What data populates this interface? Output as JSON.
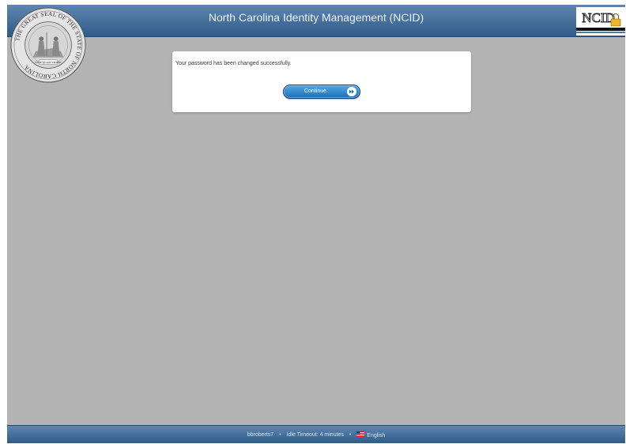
{
  "header": {
    "title": "North Carolina Identity Management (NCID)",
    "seal_text_top": "THE GREAT SEAL OF THE STATE OF NORTH CAROLINA",
    "seal_motto": "ESSE QUAM VIDERI",
    "logo_text": "NCID"
  },
  "dialog": {
    "message": "Your password has been changed successfully.",
    "continue_label": "Continue"
  },
  "footer": {
    "username": "bbroberts7",
    "separator": "•",
    "idle_timeout": "Idle Timeout: 4 minutes",
    "language": "English"
  },
  "colors": {
    "header_bg": "#2e5b88",
    "page_bg": "#b3b3b3",
    "button_bg": "#1f6fb7"
  },
  "icons": {
    "continue": "fast-forward-icon",
    "language": "us-flag-icon"
  }
}
